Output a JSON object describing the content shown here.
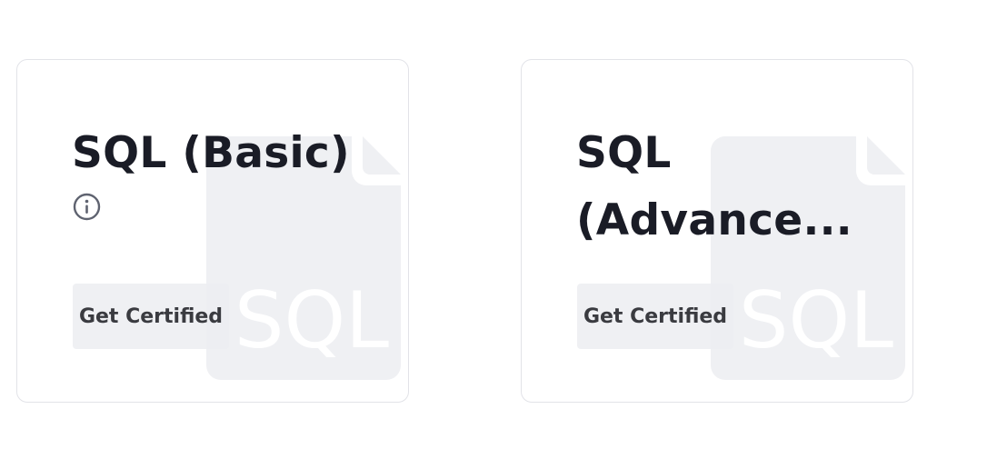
{
  "cards": [
    {
      "title": "SQL (Basic)",
      "button_label": "Get Certified",
      "has_info_icon": true,
      "icon": "info-circle-icon",
      "illustration_icon": "sql-file-icon",
      "illustration_text": "SQL"
    },
    {
      "title": "SQL (Advance...",
      "button_label": "Get Certified",
      "has_info_icon": false,
      "illustration_icon": "sql-file-icon",
      "illustration_text": "SQL"
    }
  ],
  "colors": {
    "title": "#1a1c26",
    "card_border": "#e2e3e8",
    "illustration": "#eff0f3",
    "button_bg": "#ecedf1",
    "button_text": "#3a3b40",
    "info_icon": "#5f6370"
  }
}
